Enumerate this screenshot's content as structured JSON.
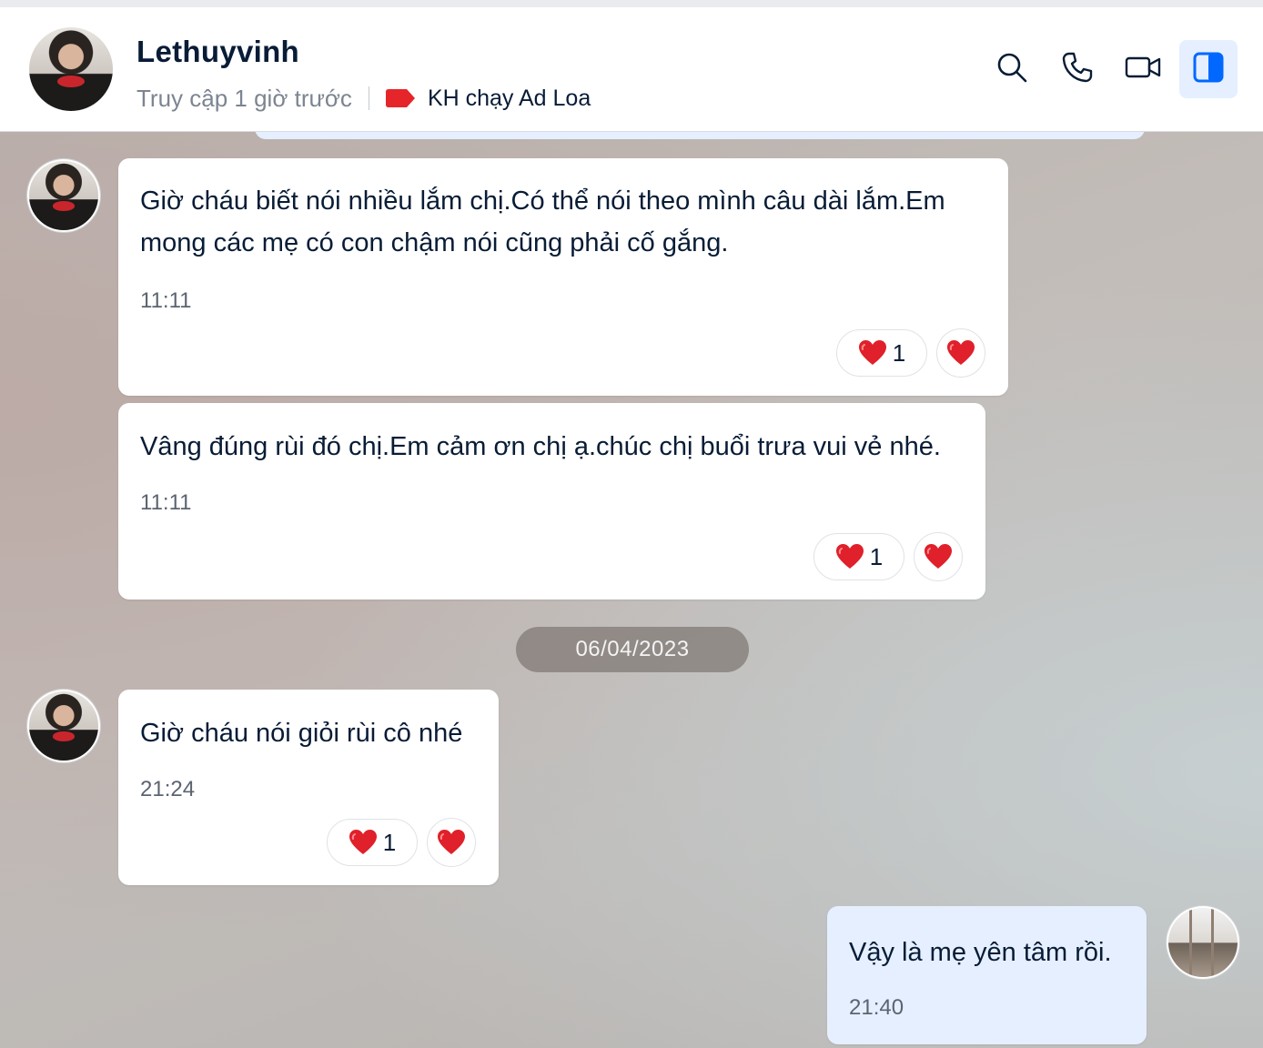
{
  "header": {
    "contact_name": "Lethuyvinh",
    "last_seen": "Truy cập 1 giờ trước",
    "tag_label": "KH chạy Ad Loa",
    "tag_color": "#e5252a",
    "actions": [
      "search-icon",
      "phone-icon",
      "video-call-icon",
      "toggle-sidebar-icon"
    ]
  },
  "messages": [
    {
      "sender": "contact",
      "text_lines": [
        "Giờ cháu biết nói nhiều lắm chị.Có thể nói theo mình câu dài lắm.Em",
        "mong các mẹ có con chậm nói cũng phải cố gắng."
      ],
      "time": "11:11",
      "reaction_count": "1",
      "reaction": "heart"
    },
    {
      "sender": "contact",
      "text_lines": [
        "Vâng đúng rùi đó chị.Em cảm ơn chị ạ.chúc chị buổi trưa vui vẻ nhé."
      ],
      "time": "11:11",
      "reaction_count": "1",
      "reaction": "heart"
    },
    {
      "sender": "contact",
      "text_lines": [
        "Giờ cháu nói giỏi rùi cô nhé"
      ],
      "time": "21:24",
      "reaction_count": "1",
      "reaction": "heart"
    },
    {
      "sender": "me",
      "text_lines": [
        "Vậy là mẹ yên tâm rồi."
      ],
      "time": "21:40"
    }
  ],
  "date_separator": "06/04/2023",
  "colors": {
    "accent": "#0068ff",
    "my_bubble": "#e5efff",
    "heart": "#e0202a"
  }
}
